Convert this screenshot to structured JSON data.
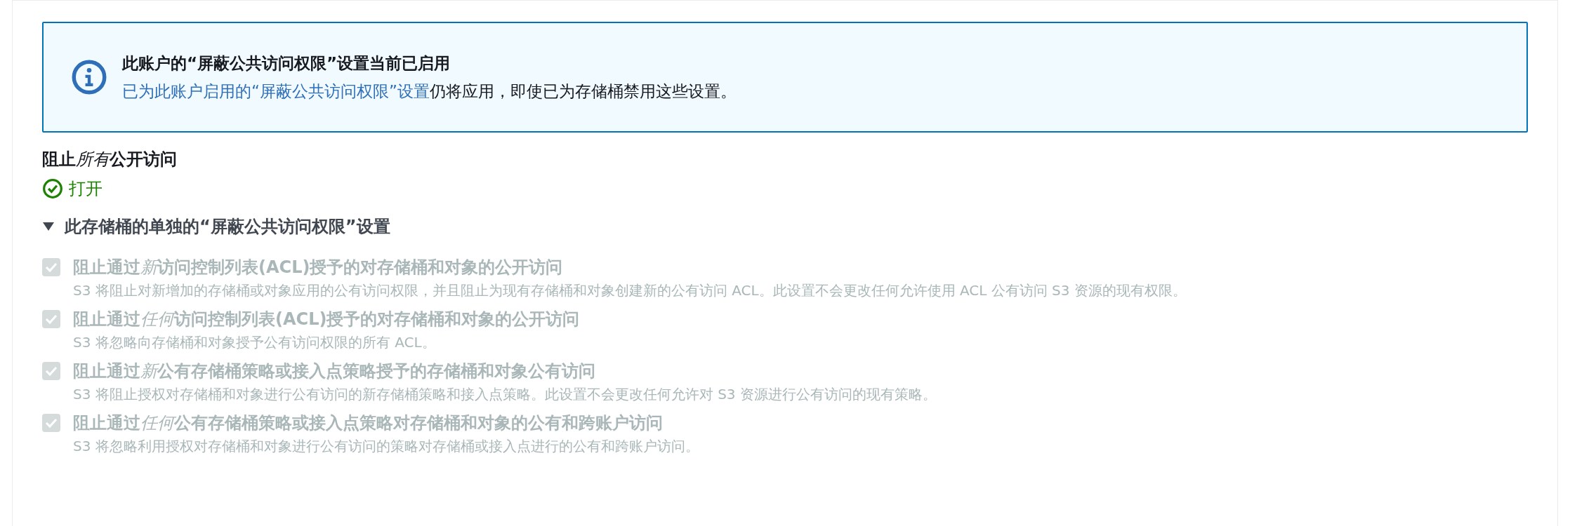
{
  "alert": {
    "title": "此账户的“屏蔽公共访问权限”设置当前已启用",
    "link": "已为此账户启用的“屏蔽公共访问权限”设置",
    "text": "仍将应用，即使已为存储桶禁用这些设置。"
  },
  "block_all": {
    "label": [
      "阻止",
      "所有",
      "公开访问"
    ],
    "status": "打开",
    "on": true
  },
  "section": {
    "title": "此存储桶的单独的“屏蔽公共访问权限”设置",
    "expanded": true
  },
  "options": [
    {
      "label": [
        "阻止通过",
        "新",
        "访问控制列表(ACL)授予的对存储桶和对象的公开访问"
      ],
      "description": "S3 将阻止对新增加的存储桶或对象应用的公有访问权限，并且阻止为现有存储桶和对象创建新的公有访问 ACL。此设置不会更改任何允许使用 ACL 公有访问 S3 资源的现有权限。",
      "checked": true,
      "disabled": true
    },
    {
      "label": [
        "阻止通过",
        "任何",
        "访问控制列表(ACL)授予的对存储桶和对象的公开访问"
      ],
      "description": "S3 将忽略向存储桶和对象授予公有访问权限的所有 ACL。",
      "checked": true,
      "disabled": true
    },
    {
      "label": [
        "阻止通过",
        "新",
        "公有存储桶策略或接入点策略授予的存储桶和对象公有访问"
      ],
      "description": "S3 将阻止授权对存储桶和对象进行公有访问的新存储桶策略和接入点策略。此设置不会更改任何允许对 S3 资源进行公有访问的现有策略。",
      "checked": true,
      "disabled": true
    },
    {
      "label": [
        "阻止通过",
        "任何",
        "公有存储桶策略或接入点策略对存储桶和对象的公有和跨账户访问"
      ],
      "description": "S3 将忽略利用授权对存储桶和对象进行公有访问的策略对存储桶或接入点进行的公有和跨账户访问。",
      "checked": true,
      "disabled": true
    }
  ]
}
